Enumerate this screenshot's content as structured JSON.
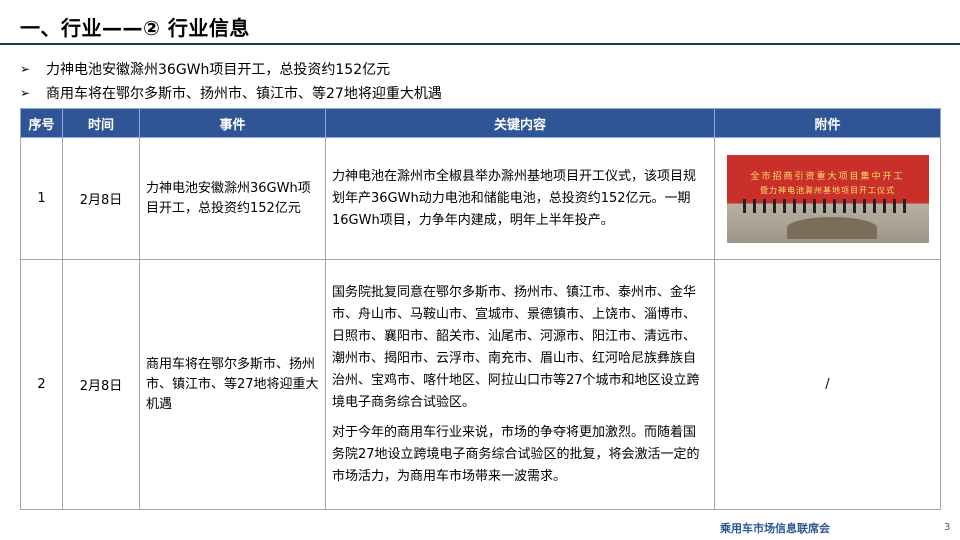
{
  "title": "一、行业——② 行业信息",
  "bullets": [
    "力神电池安徽滁州36GWh项目开工，总投资约152亿元",
    "商用车将在鄂尔多斯市、扬州市、镇江市、等27地将迎重大机遇"
  ],
  "table": {
    "headers": [
      "序号",
      "时间",
      "事件",
      "关键内容",
      "附件"
    ],
    "rows": [
      {
        "no": "1",
        "date": "2月8日",
        "event": "力神电池安徽滁州36GWh项目开工，总投资约152亿元",
        "content": [
          "力神电池在滁州市全椒县举办滁州基地项目开工仪式，该项目规划年产36GWh动力电池和储能电池，总投资约152亿元。一期16GWh项目，力争年内建成，明年上半年投产。"
        ],
        "attachment_banner_1": "全市招商引资重大项目集中开工",
        "attachment_banner_2": "暨力神电池滁州基地项目开工仪式"
      },
      {
        "no": "2",
        "date": "2月8日",
        "event": "商用车将在鄂尔多斯市、扬州市、镇江市、等27地将迎重大机遇",
        "content": [
          "国务院批复同意在鄂尔多斯市、扬州市、镇江市、泰州市、金华市、舟山市、马鞍山市、宣城市、景德镇市、上饶市、淄博市、日照市、襄阳市、韶关市、汕尾市、河源市、阳江市、清远市、潮州市、揭阳市、云浮市、南充市、眉山市、红河哈尼族彝族自治州、宝鸡市、喀什地区、阿拉山口市等27个城市和地区设立跨境电子商务综合试验区。",
          "对于今年的商用车行业来说，市场的争夺将更加激烈。而随着国务院27地设立跨境电子商务综合试验区的批复，将会激活一定的市场活力，为商用车市场带来一波需求。"
        ],
        "attachment": "/"
      }
    ]
  },
  "footer": "乘用车市场信息联席会",
  "page_number": "3",
  "colors": {
    "header_bg": "#2f5597",
    "title_rule": "#1f3864",
    "footer": "#2f5597"
  },
  "icons": {
    "bullet": "arrow-right-icon"
  }
}
